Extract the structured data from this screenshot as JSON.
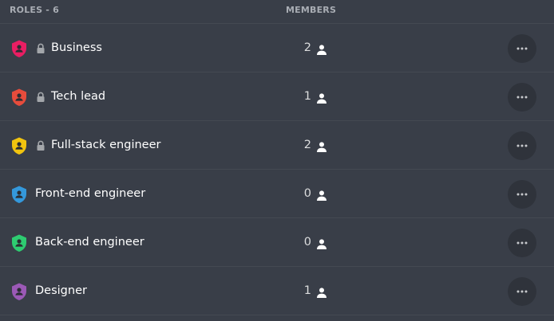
{
  "header": {
    "roles_label": "ROLES - 6",
    "members_label": "MEMBERS"
  },
  "roles": [
    {
      "name": "Business",
      "color": "#e91e63",
      "locked": true,
      "members": "2"
    },
    {
      "name": "Tech lead",
      "color": "#e74c3c",
      "locked": true,
      "members": "1"
    },
    {
      "name": "Full-stack engineer",
      "color": "#f1c40f",
      "locked": true,
      "members": "2"
    },
    {
      "name": "Front-end engineer",
      "color": "#3498db",
      "locked": false,
      "members": "0"
    },
    {
      "name": "Back-end engineer",
      "color": "#2ecc71",
      "locked": false,
      "members": "0"
    },
    {
      "name": "Designer",
      "color": "#9b59b6",
      "locked": false,
      "members": "1"
    }
  ],
  "icons": {
    "role": "shield-person-icon",
    "lock": "lock-icon",
    "members": "person-icon",
    "more": "more-options-icon"
  },
  "colors": {
    "background": "#393e48",
    "divider": "#444952",
    "header_text": "#a9adb4",
    "more_button_bg": "#2f333b"
  }
}
